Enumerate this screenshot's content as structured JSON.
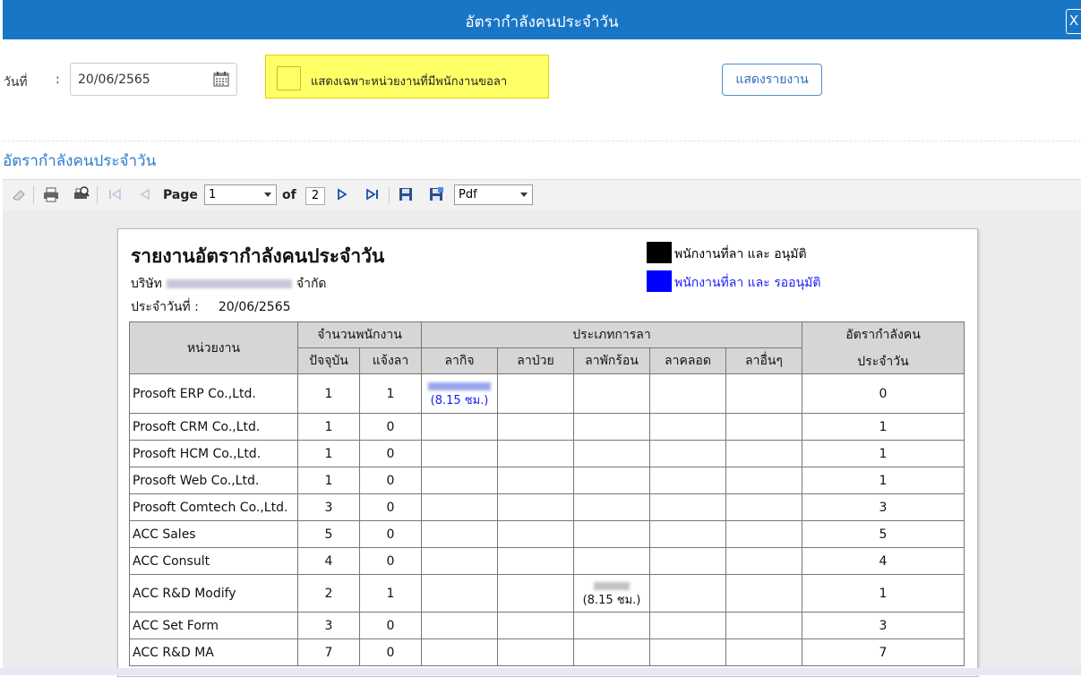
{
  "window": {
    "title": "อัตรากำลังคนประจำวัน",
    "close_label": "X"
  },
  "filter": {
    "date_label": "วันที่",
    "colon": ":",
    "date_value": "20/06/2565",
    "checkbox_label": "แสดงเฉพาะหน่วยงานที่มีพนักงานขอลา",
    "show_button": "แสดงรายงาน"
  },
  "section_title": "อัตรากำลังคนประจำวัน",
  "toolbar": {
    "page_label": "Page",
    "page_value": "1",
    "of_label": "of",
    "total_pages": "2",
    "export_format": "Pdf",
    "icons": [
      "eraser-icon",
      "print-icon",
      "print-preview-icon",
      "first-page-icon",
      "prev-page-icon",
      "next-page-icon",
      "last-page-icon",
      "save-icon",
      "save-as-icon"
    ]
  },
  "report": {
    "title": "รายงานอัตรากำลังคนประจำวัน",
    "company_prefix": "บริษัท",
    "company_suffix": "จำกัด",
    "date_label": "ประจำวันที่ :",
    "date_value": "20/06/2565",
    "legend": [
      {
        "color": "#000000",
        "label": "พนักงานที่ลา และ อนุมัติ"
      },
      {
        "color": "#0000ff",
        "label": "พนักงานที่ลา และ รออนุมัติ"
      }
    ],
    "headers": {
      "department": "หน่วยงาน",
      "employee_count": "จำนวนพนักงาน",
      "current": "ปัจจุบัน",
      "notified": "แจ้งลา",
      "leave_type": "ประเภทการลา",
      "business": "ลากิจ",
      "sick": "ลาป่วย",
      "vacation": "ลาพักร้อน",
      "maternity": "ลาคลอด",
      "other": "ลาอื่นๆ",
      "rate_line1": "อัตรากำลังคน",
      "rate_line2": "ประจำวัน"
    },
    "rows": [
      {
        "department": "Prosoft ERP Co.,Ltd.",
        "current": "1",
        "notified": "1",
        "business": "(8.15 ชม.)",
        "vacation": "",
        "rate": "0"
      },
      {
        "department": "Prosoft CRM Co.,Ltd.",
        "current": "1",
        "notified": "0",
        "business": "",
        "vacation": "",
        "rate": "1"
      },
      {
        "department": "Prosoft HCM Co.,Ltd.",
        "current": "1",
        "notified": "0",
        "business": "",
        "vacation": "",
        "rate": "1"
      },
      {
        "department": "Prosoft Web Co.,Ltd.",
        "current": "1",
        "notified": "0",
        "business": "",
        "vacation": "",
        "rate": "1"
      },
      {
        "department": "Prosoft Comtech Co.,Ltd.",
        "current": "3",
        "notified": "0",
        "business": "",
        "vacation": "",
        "rate": "3"
      },
      {
        "department": "ACC Sales",
        "current": "5",
        "notified": "0",
        "business": "",
        "vacation": "",
        "rate": "5"
      },
      {
        "department": "ACC Consult",
        "current": "4",
        "notified": "0",
        "business": "",
        "vacation": "",
        "rate": "4"
      },
      {
        "department": "ACC R&D Modify",
        "current": "2",
        "notified": "1",
        "business": "",
        "vacation": "(8.15 ชม.)",
        "rate": "1"
      },
      {
        "department": "ACC Set Form",
        "current": "3",
        "notified": "0",
        "business": "",
        "vacation": "",
        "rate": "3"
      },
      {
        "department": "ACC R&D MA",
        "current": "7",
        "notified": "0",
        "business": "",
        "vacation": "",
        "rate": "7"
      }
    ]
  }
}
